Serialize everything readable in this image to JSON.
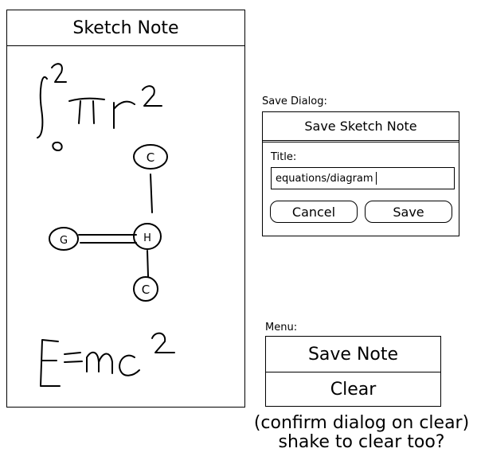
{
  "sketch": {
    "title": "Sketch Note",
    "atoms": {
      "top": "C",
      "center": "H",
      "left": "G",
      "bottom": "C"
    }
  },
  "save_dialog": {
    "caption": "Save Dialog:",
    "title": "Save Sketch Note",
    "field_label": "Title:",
    "field_value": "equations/diagram",
    "cancel_label": "Cancel",
    "save_label": "Save"
  },
  "menu": {
    "caption": "Menu:",
    "items": [
      "Save Note",
      "Clear"
    ]
  },
  "notes": {
    "line1": "(confirm dialog on clear)",
    "line2": "shake to clear too?"
  }
}
